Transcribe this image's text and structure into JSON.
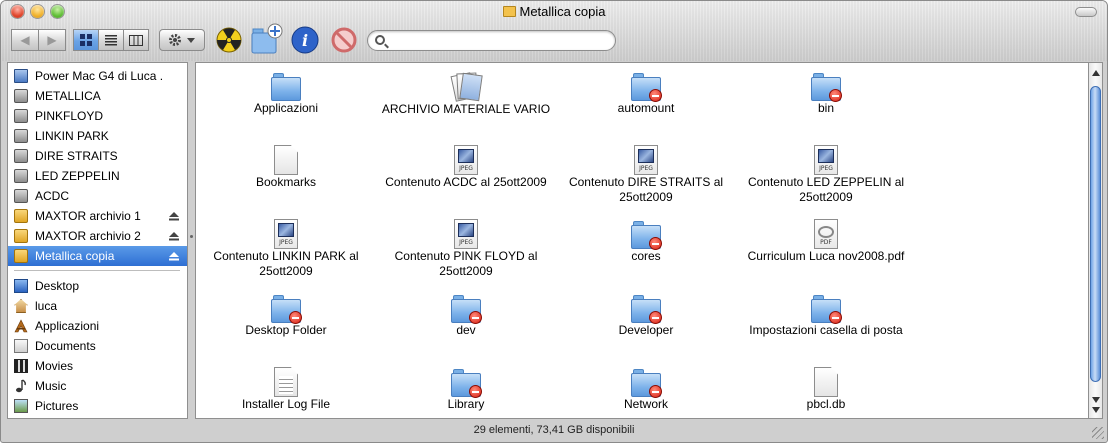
{
  "window": {
    "title": "Metallica copia"
  },
  "toolbar": {
    "back_label": "◀",
    "forward_label": "▶",
    "search_placeholder": "",
    "search_value": ""
  },
  "sidebar": {
    "devices": [
      {
        "label": "Power Mac G4 di Luca .",
        "icon": "computer-icon",
        "eject": false
      },
      {
        "label": "METALLICA",
        "icon": "disk-icon",
        "eject": false
      },
      {
        "label": "PINKFLOYD",
        "icon": "disk-icon",
        "eject": false
      },
      {
        "label": "LINKIN PARK",
        "icon": "disk-icon",
        "eject": false
      },
      {
        "label": "DIRE STRAITS",
        "icon": "disk-icon",
        "eject": false
      },
      {
        "label": "LED ZEPPELIN",
        "icon": "disk-icon",
        "eject": false
      },
      {
        "label": "ACDC",
        "icon": "disk-icon",
        "eject": false
      },
      {
        "label": "MAXTOR archivio 1",
        "icon": "external-disk-icon",
        "eject": true
      },
      {
        "label": "MAXTOR archivio 2",
        "icon": "external-disk-icon",
        "eject": true
      },
      {
        "label": "Metallica copia",
        "icon": "external-disk-icon",
        "eject": true,
        "selected": true
      }
    ],
    "places": [
      {
        "label": "Desktop",
        "icon": "desktop-icon"
      },
      {
        "label": "luca",
        "icon": "home-icon"
      },
      {
        "label": "Applicazioni",
        "icon": "applications-icon"
      },
      {
        "label": "Documents",
        "icon": "documents-icon"
      },
      {
        "label": "Movies",
        "icon": "movies-icon"
      },
      {
        "label": "Music",
        "icon": "music-icon"
      },
      {
        "label": "Pictures",
        "icon": "pictures-icon"
      }
    ]
  },
  "files": [
    {
      "name": "Applicazioni",
      "kind": "folder"
    },
    {
      "name": "ARCHIVIO MATERIALE VARIO",
      "kind": "stack"
    },
    {
      "name": "automount",
      "kind": "folder-restricted"
    },
    {
      "name": "bin",
      "kind": "folder-restricted"
    },
    {
      "name": "Bookmarks",
      "kind": "document"
    },
    {
      "name": "Contenuto ACDC al 25ott2009",
      "kind": "jpeg"
    },
    {
      "name": "Contenuto DIRE STRAITS al 25ott2009",
      "kind": "jpeg"
    },
    {
      "name": "Contenuto LED ZEPPELIN al 25ott2009",
      "kind": "jpeg"
    },
    {
      "name": "Contenuto LINKIN PARK al 25ott2009",
      "kind": "jpeg"
    },
    {
      "name": "Contenuto PINK FLOYD al 25ott2009",
      "kind": "jpeg"
    },
    {
      "name": "cores",
      "kind": "folder-restricted"
    },
    {
      "name": "Curriculum Luca nov2008.pdf",
      "kind": "pdf"
    },
    {
      "name": "Desktop Folder",
      "kind": "folder-restricted"
    },
    {
      "name": "dev",
      "kind": "folder-restricted"
    },
    {
      "name": "Developer",
      "kind": "folder-restricted"
    },
    {
      "name": "Impostazioni casella di posta",
      "kind": "folder-restricted"
    },
    {
      "name": "Installer Log File",
      "kind": "text-document"
    },
    {
      "name": "Library",
      "kind": "folder-restricted"
    },
    {
      "name": "Network",
      "kind": "folder-restricted"
    },
    {
      "name": "pbcl.db",
      "kind": "document"
    }
  ],
  "file_tags": {
    "jpeg": "JPEG",
    "pdf": "PDF"
  },
  "status_bar": {
    "text": "29 elementi, 73,41 GB disponibili"
  },
  "colors": {
    "selection": "#3a7bd9",
    "folder": "#7db2ea",
    "restricted_badge": "#d81e10"
  }
}
